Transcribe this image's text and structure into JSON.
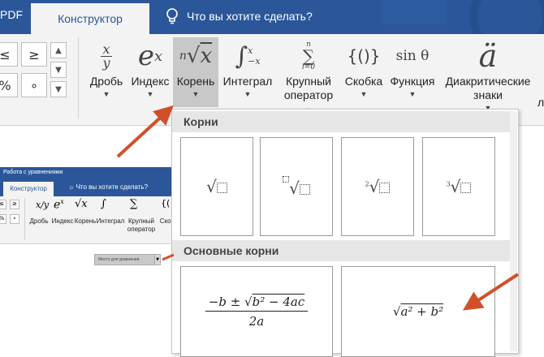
{
  "tabs": {
    "partial_left": "PDF",
    "active": "Конструктор",
    "tell_me": "Что вы хотите сделать?"
  },
  "ribbon": {
    "symbols": [
      "≤",
      "≥",
      "%",
      "∘"
    ],
    "buttons": [
      {
        "label": "Дробь",
        "icon": "fraction-icon"
      },
      {
        "label": "Индекс",
        "icon": "script-icon"
      },
      {
        "label": "Корень",
        "icon": "radical-icon",
        "selected": true
      },
      {
        "label": "Интеграл",
        "icon": "integral-icon"
      },
      {
        "label_line1": "Крупный",
        "label_line2": "оператор",
        "icon": "large-operator-icon"
      },
      {
        "label": "Скобка",
        "icon": "bracket-icon"
      },
      {
        "label": "Функция",
        "icon": "function-icon"
      },
      {
        "label_line1": "Диакритические",
        "label_line2": "знаки",
        "icon": "accent-icon"
      }
    ],
    "partial_right": "л"
  },
  "dropdown": {
    "section1": "Корни",
    "section2": "Основные корни",
    "quadratic": {
      "numerator_pre": "−b ± ",
      "numerator_rad": "b² − 4ac",
      "denominator": "2a"
    },
    "pythagoras": "a² + b²"
  },
  "embedded": {
    "title": "Работа с уравнениями",
    "tab": "Конструктор",
    "tell_me": "Что вы хотите сделать?",
    "labels": [
      "Дробь",
      "Индекс",
      "Корень",
      "Интеграл",
      "Крупный",
      "оператор",
      "Скоб"
    ],
    "placeholder": "Место для уравнения."
  },
  "colors": {
    "ribbon_blue": "#2b579a",
    "arrow": "#d0502a",
    "selected": "#c8c8c8"
  }
}
